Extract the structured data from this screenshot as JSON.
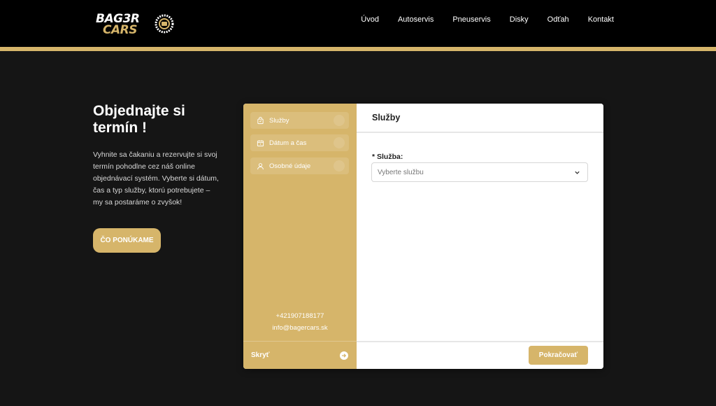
{
  "brand": {
    "line1": "BAG3R",
    "line2": "CARS",
    "accent_color": "#d6b56a",
    "icon": "tire-icon"
  },
  "nav": {
    "items": [
      "Úvod",
      "Autoservis",
      "Pneuservis",
      "Disky",
      "Odťah",
      "Kontakt"
    ]
  },
  "hero": {
    "title": "Objednajte si termín !",
    "text": "Vyhnite sa čakaniu a rezervujte si svoj termín pohodlne cez náš online objednávací systém. Vyberte si dátum, čas a typ služby, ktorú potrebujete – my sa postaráme o zvyšok!",
    "cta_label": "ČO PONÚKAME"
  },
  "booking": {
    "steps": [
      {
        "label": "Služby",
        "icon": "bag-icon"
      },
      {
        "label": "Dátum a čas",
        "icon": "calendar-icon"
      },
      {
        "label": "Osobné údaje",
        "icon": "user-icon"
      }
    ],
    "phone": "+421907188177",
    "email": "info@bagercars.sk",
    "hide_label": "Skryť",
    "panel_title": "Služby",
    "field_label": "* Služba:",
    "select_placeholder": "Vyberte službu",
    "continue_label": "Pokračovať"
  }
}
